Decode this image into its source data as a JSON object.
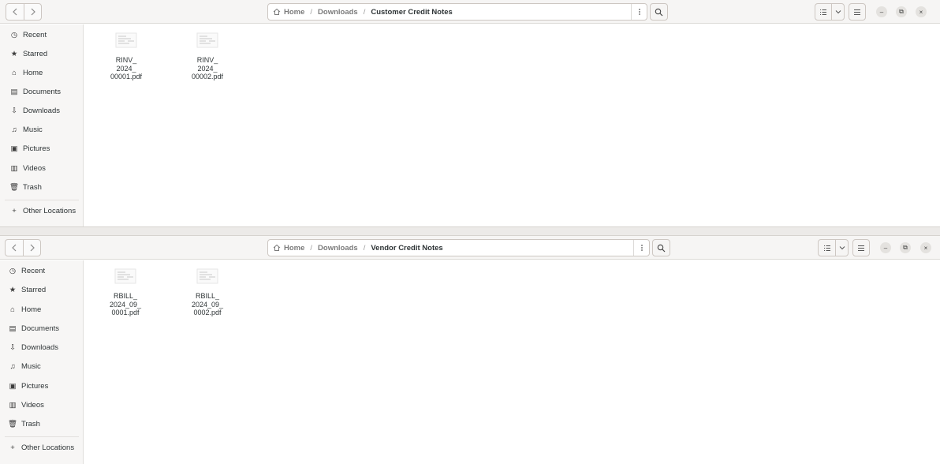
{
  "windows": [
    {
      "nav": {
        "back_icon": "chevron-left-icon",
        "forward_icon": "chevron-right-icon"
      },
      "path": {
        "home_icon": "home-icon",
        "home": "Home",
        "sep1": "/",
        "downloads": "Downloads",
        "sep2": "/",
        "current": "Customer Credit Notes",
        "menu_icon": "more-vertical-icon"
      },
      "toolbar": {
        "search_icon": "search-icon",
        "view_icon": "list-view-icon",
        "view_dropdown_icon": "chevron-down-icon",
        "menu_icon": "hamburger-menu-icon"
      },
      "window_controls": {
        "minimize": "–",
        "restore": "⧉",
        "close": "×"
      },
      "sidebar": [
        {
          "label": "Recent",
          "icon": "clock-icon",
          "glyph": "◷"
        },
        {
          "label": "Starred",
          "icon": "star-icon",
          "glyph": "★"
        },
        {
          "label": "Home",
          "icon": "home-icon",
          "glyph": "⌂"
        },
        {
          "label": "Documents",
          "icon": "document-icon",
          "glyph": "▤"
        },
        {
          "label": "Downloads",
          "icon": "download-icon",
          "glyph": "⇩"
        },
        {
          "label": "Music",
          "icon": "music-icon",
          "glyph": "♫"
        },
        {
          "label": "Pictures",
          "icon": "picture-icon",
          "glyph": "▣"
        },
        {
          "label": "Videos",
          "icon": "film-icon",
          "glyph": "▥"
        },
        {
          "label": "Trash",
          "icon": "trash-icon",
          "glyph": "🗑"
        }
      ],
      "other_locations": {
        "label": "Other Locations",
        "glyph": "+"
      },
      "files": [
        {
          "name": "RINV_\n2024_\n00001.pdf",
          "icon": "pdf-file-icon"
        },
        {
          "name": "RINV_\n2024_\n00002.pdf",
          "icon": "pdf-file-icon"
        }
      ]
    },
    {
      "nav": {
        "back_icon": "chevron-left-icon",
        "forward_icon": "chevron-right-icon"
      },
      "path": {
        "home_icon": "home-icon",
        "home": "Home",
        "sep1": "/",
        "downloads": "Downloads",
        "sep2": "/",
        "current": "Vendor Credit Notes",
        "menu_icon": "more-vertical-icon"
      },
      "toolbar": {
        "search_icon": "search-icon",
        "view_icon": "list-view-icon",
        "view_dropdown_icon": "chevron-down-icon",
        "menu_icon": "hamburger-menu-icon"
      },
      "window_controls": {
        "minimize": "–",
        "restore": "⧉",
        "close": "×"
      },
      "sidebar": [
        {
          "label": "Recent",
          "icon": "clock-icon",
          "glyph": "◷"
        },
        {
          "label": "Starred",
          "icon": "star-icon",
          "glyph": "★"
        },
        {
          "label": "Home",
          "icon": "home-icon",
          "glyph": "⌂"
        },
        {
          "label": "Documents",
          "icon": "document-icon",
          "glyph": "▤"
        },
        {
          "label": "Downloads",
          "icon": "download-icon",
          "glyph": "⇩"
        },
        {
          "label": "Music",
          "icon": "music-icon",
          "glyph": "♫"
        },
        {
          "label": "Pictures",
          "icon": "picture-icon",
          "glyph": "▣"
        },
        {
          "label": "Videos",
          "icon": "film-icon",
          "glyph": "▥"
        },
        {
          "label": "Trash",
          "icon": "trash-icon",
          "glyph": "🗑"
        }
      ],
      "other_locations": {
        "label": "Other Locations",
        "glyph": "+"
      },
      "files": [
        {
          "name": "RBILL_\n2024_09_\n0001.pdf",
          "icon": "pdf-file-icon"
        },
        {
          "name": "RBILL_\n2024_09_\n0002.pdf",
          "icon": "pdf-file-icon"
        }
      ]
    }
  ]
}
